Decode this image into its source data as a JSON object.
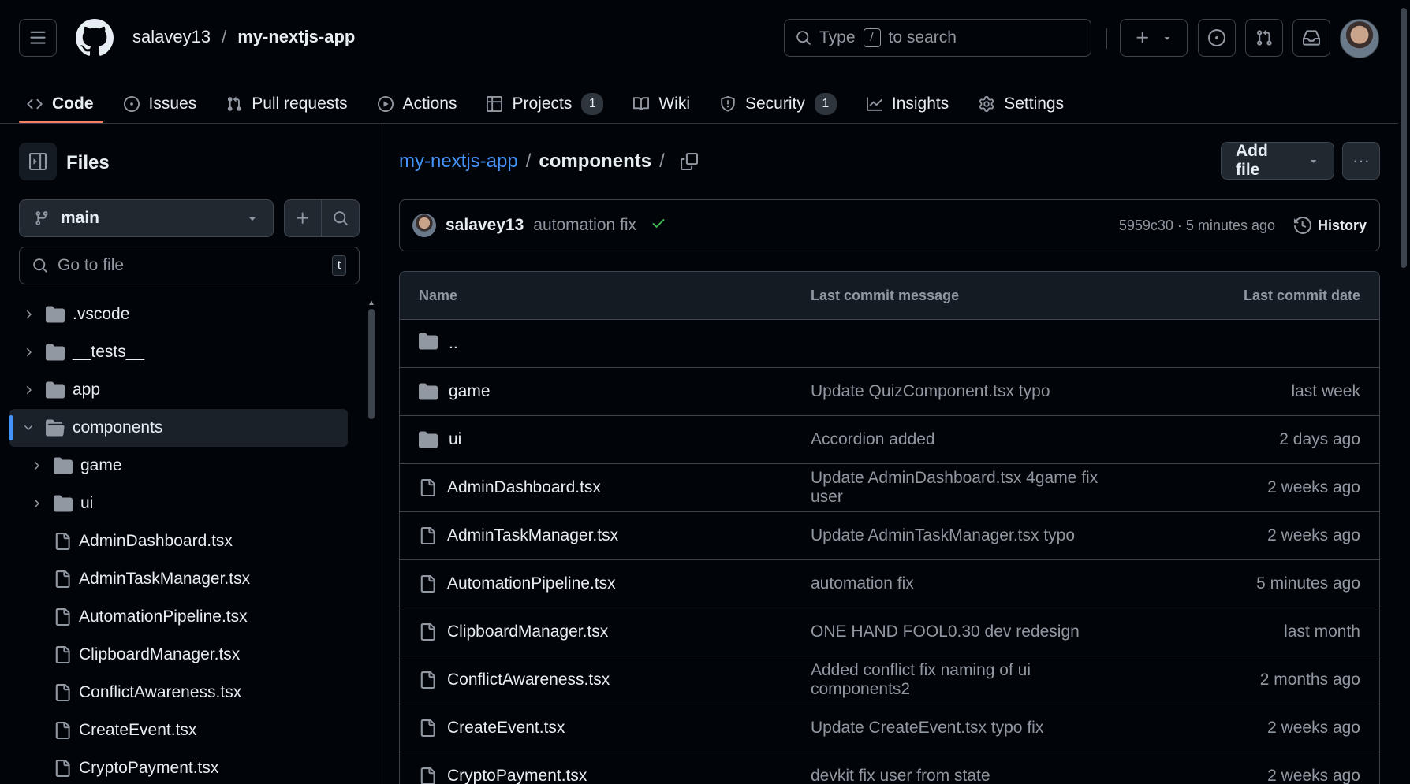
{
  "header": {
    "owner": "salavey13",
    "separator": "/",
    "repo": "my-nextjs-app",
    "search_prefix": "Type",
    "search_key": "/",
    "search_suffix": "to search"
  },
  "tabs": [
    {
      "label": "Code",
      "count": null,
      "icon": "code-icon"
    },
    {
      "label": "Issues",
      "count": null,
      "icon": "issue-icon"
    },
    {
      "label": "Pull requests",
      "count": null,
      "icon": "pull-request-icon"
    },
    {
      "label": "Actions",
      "count": null,
      "icon": "play-icon"
    },
    {
      "label": "Projects",
      "count": "1",
      "icon": "table-icon"
    },
    {
      "label": "Wiki",
      "count": null,
      "icon": "book-icon"
    },
    {
      "label": "Security",
      "count": "1",
      "icon": "shield-icon"
    },
    {
      "label": "Insights",
      "count": null,
      "icon": "graph-icon"
    },
    {
      "label": "Settings",
      "count": null,
      "icon": "gear-icon"
    }
  ],
  "sidebar": {
    "title": "Files",
    "branch": "main",
    "goto_placeholder": "Go to file",
    "goto_key": "t",
    "tree": [
      {
        "label": ".vscode",
        "type": "folder",
        "depth": 0,
        "expanded": false
      },
      {
        "label": "__tests__",
        "type": "folder",
        "depth": 0,
        "expanded": false
      },
      {
        "label": "app",
        "type": "folder",
        "depth": 0,
        "expanded": false
      },
      {
        "label": "components",
        "type": "folder",
        "depth": 0,
        "expanded": true,
        "selected": true
      },
      {
        "label": "game",
        "type": "folder",
        "depth": 1,
        "expanded": false
      },
      {
        "label": "ui",
        "type": "folder",
        "depth": 1,
        "expanded": false
      },
      {
        "label": "AdminDashboard.tsx",
        "type": "file",
        "depth": 1
      },
      {
        "label": "AdminTaskManager.tsx",
        "type": "file",
        "depth": 1
      },
      {
        "label": "AutomationPipeline.tsx",
        "type": "file",
        "depth": 1
      },
      {
        "label": "ClipboardManager.tsx",
        "type": "file",
        "depth": 1
      },
      {
        "label": "ConflictAwareness.tsx",
        "type": "file",
        "depth": 1
      },
      {
        "label": "CreateEvent.tsx",
        "type": "file",
        "depth": 1
      },
      {
        "label": "CryptoPayment.tsx",
        "type": "file",
        "depth": 1
      }
    ]
  },
  "main": {
    "path_root": "my-nextjs-app",
    "path_sep": "/",
    "path_current": "components",
    "path_trailing": "/",
    "add_file": "Add file",
    "commit": {
      "author": "salavey13",
      "message": "automation fix",
      "meta": "5959c30 · 5 minutes ago",
      "history": "History"
    },
    "columns": {
      "name": "Name",
      "message": "Last commit message",
      "date": "Last commit date"
    },
    "parent": "..",
    "rows": [
      {
        "name": "game",
        "type": "folder",
        "message": "Update QuizComponent.tsx typo",
        "date": "last week"
      },
      {
        "name": "ui",
        "type": "folder",
        "message": "Accordion added",
        "date": "2 days ago"
      },
      {
        "name": "AdminDashboard.tsx",
        "type": "file",
        "message": "Update AdminDashboard.tsx 4game fix user",
        "date": "2 weeks ago"
      },
      {
        "name": "AdminTaskManager.tsx",
        "type": "file",
        "message": "Update AdminTaskManager.tsx typo",
        "date": "2 weeks ago"
      },
      {
        "name": "AutomationPipeline.tsx",
        "type": "file",
        "message": "automation fix",
        "date": "5 minutes ago"
      },
      {
        "name": "ClipboardManager.tsx",
        "type": "file",
        "message": "ONE HAND FOOL0.30 dev redesign",
        "date": "last month"
      },
      {
        "name": "ConflictAwareness.tsx",
        "type": "file",
        "message": "Added conflict fix naming of ui components2",
        "date": "2 months ago"
      },
      {
        "name": "CreateEvent.tsx",
        "type": "file",
        "message": "Update CreateEvent.tsx typo fix",
        "date": "2 weeks ago"
      },
      {
        "name": "CryptoPayment.tsx",
        "type": "file",
        "message": "devkit fix user from state",
        "date": "2 weeks ago"
      }
    ]
  },
  "colors": {
    "accent": "#4493f8",
    "tab_underline": "#f78166",
    "success": "#3fb950",
    "bg": "#010409",
    "border": "#3d444d"
  }
}
